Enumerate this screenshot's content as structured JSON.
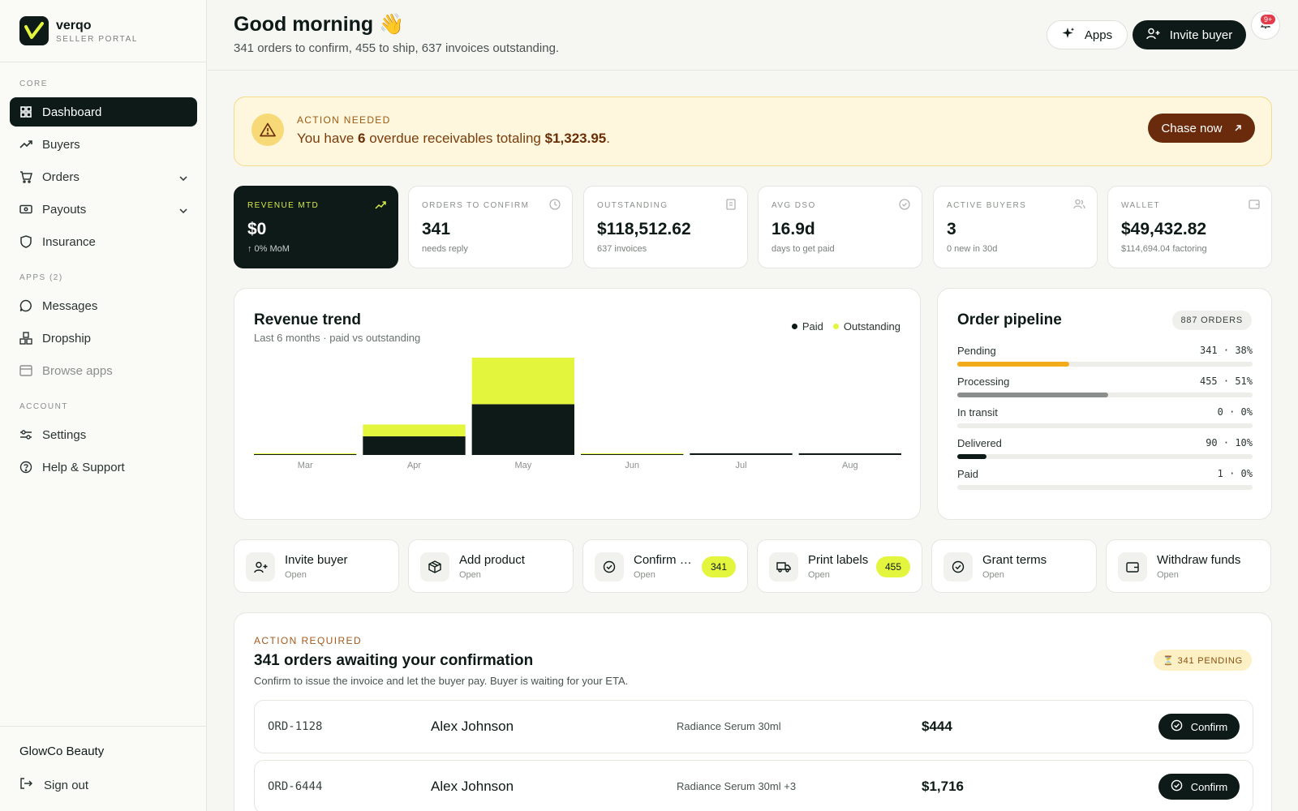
{
  "brand": {
    "name": "verqo",
    "subtitle": "SELLER PORTAL"
  },
  "sidebar": {
    "sections": {
      "core": "CORE",
      "apps": "APPS (2)",
      "account": "ACCOUNT"
    },
    "items": [
      {
        "label": "Dashboard",
        "icon": "grid-icon",
        "active": true
      },
      {
        "label": "Buyers",
        "icon": "trend-icon"
      },
      {
        "label": "Orders",
        "icon": "cart-icon",
        "has_children": true
      },
      {
        "label": "Payouts",
        "icon": "banknote-icon",
        "has_children": true
      },
      {
        "label": "Insurance",
        "icon": "shield-icon"
      },
      {
        "label": "Messages",
        "icon": "chat-icon"
      },
      {
        "label": "Dropship",
        "icon": "boxes-icon"
      },
      {
        "label": "Browse apps",
        "icon": "browser-icon"
      },
      {
        "label": "Settings",
        "icon": "sliders-icon"
      },
      {
        "label": "Help & Support",
        "icon": "help-icon"
      }
    ],
    "company": "GlowCo Beauty",
    "signout": "Sign out"
  },
  "header": {
    "greeting": "Good morning 👋",
    "summary": "341 orders to confirm, 455 to ship, 637 invoices outstanding.",
    "apps_label": "Apps",
    "invite_label": "Invite buyer",
    "notif_badge": "9+"
  },
  "alert": {
    "label": "ACTION NEEDED",
    "text_pre": "You have ",
    "count": "6",
    "text_mid": " overdue receivables totaling ",
    "amount": "$1,323.95",
    "text_post": ".",
    "button": "Chase now"
  },
  "kpis": [
    {
      "label": "REVENUE MTD",
      "value": "$0",
      "sub": "↑ 0% MoM",
      "icon": "trend-up-icon",
      "dark": true
    },
    {
      "label": "ORDERS TO CONFIRM",
      "value": "341",
      "sub": "needs reply",
      "icon": "clock-icon"
    },
    {
      "label": "OUTSTANDING",
      "value": "$118,512.62",
      "sub": "637 invoices",
      "icon": "receipt-icon"
    },
    {
      "label": "AVG DSO",
      "value": "16.9d",
      "sub": "days to get paid",
      "icon": "check-circle-icon"
    },
    {
      "label": "ACTIVE BUYERS",
      "value": "3",
      "sub": "0 new in 30d",
      "icon": "users-icon"
    },
    {
      "label": "WALLET",
      "value": "$49,432.82",
      "sub": "$114,694.04 factoring",
      "icon": "wallet-icon"
    }
  ],
  "revenue": {
    "title": "Revenue trend",
    "subtitle": "Last 6 months · paid vs outstanding",
    "legend": {
      "paid": "Paid",
      "outstanding": "Outstanding"
    }
  },
  "chart_data": {
    "type": "bar",
    "stacked": true,
    "title": "Revenue trend",
    "categories": [
      "Mar",
      "Apr",
      "May",
      "Jun",
      "Jul",
      "Aug"
    ],
    "series": [
      {
        "name": "Paid",
        "color": "#0e1a17",
        "values": [
          1,
          22,
          60,
          1,
          2,
          2
        ]
      },
      {
        "name": "Outstanding",
        "color": "#e4f53e",
        "values": [
          1,
          14,
          55,
          1,
          0,
          0
        ]
      }
    ],
    "ylim": [
      0,
      115
    ],
    "grid": false,
    "legend_position": "top-right"
  },
  "pipeline": {
    "title": "Order pipeline",
    "badge": "887 ORDERS",
    "rows": [
      {
        "name": "Pending",
        "count": "341 · 38%",
        "pct": 38,
        "color": "#f2ab1b"
      },
      {
        "name": "Processing",
        "count": "455 · 51%",
        "pct": 51,
        "color": "#8a8e8c"
      },
      {
        "name": "In transit",
        "count": "0 · 0%",
        "pct": 0,
        "color": "#8a8e8c"
      },
      {
        "name": "Delivered",
        "count": "90 · 10%",
        "pct": 10,
        "color": "#0e1a17"
      },
      {
        "name": "Paid",
        "count": "1 · 0%",
        "pct": 0,
        "color": "#0e1a17"
      }
    ]
  },
  "quick_actions": [
    {
      "title": "Invite buyer",
      "sub": "Open",
      "icon": "user-plus-icon"
    },
    {
      "title": "Add product",
      "sub": "Open",
      "icon": "package-icon"
    },
    {
      "title": "Confirm orders",
      "sub": "Open",
      "icon": "check-circle-icon",
      "badge": "341"
    },
    {
      "title": "Print labels",
      "sub": "Open",
      "icon": "truck-icon",
      "badge": "455"
    },
    {
      "title": "Grant terms",
      "sub": "Open",
      "icon": "check-circle-icon"
    },
    {
      "title": "Withdraw funds",
      "sub": "Open",
      "icon": "wallet-icon"
    }
  ],
  "confirm": {
    "label": "ACTION REQUIRED",
    "title": "341 orders awaiting your confirmation",
    "subtitle": "Confirm to issue the invoice and let the buyer pay. Buyer is waiting for your ETA.",
    "badge": "⏳ 341 PENDING",
    "button": "Confirm",
    "orders": [
      {
        "id": "ORD-1128",
        "buyer": "Alex Johnson",
        "product": "Radiance Serum 30ml",
        "amount": "$444"
      },
      {
        "id": "ORD-6444",
        "buyer": "Alex Johnson",
        "product": "Radiance Serum 30ml +3",
        "amount": "$1,716"
      }
    ]
  }
}
